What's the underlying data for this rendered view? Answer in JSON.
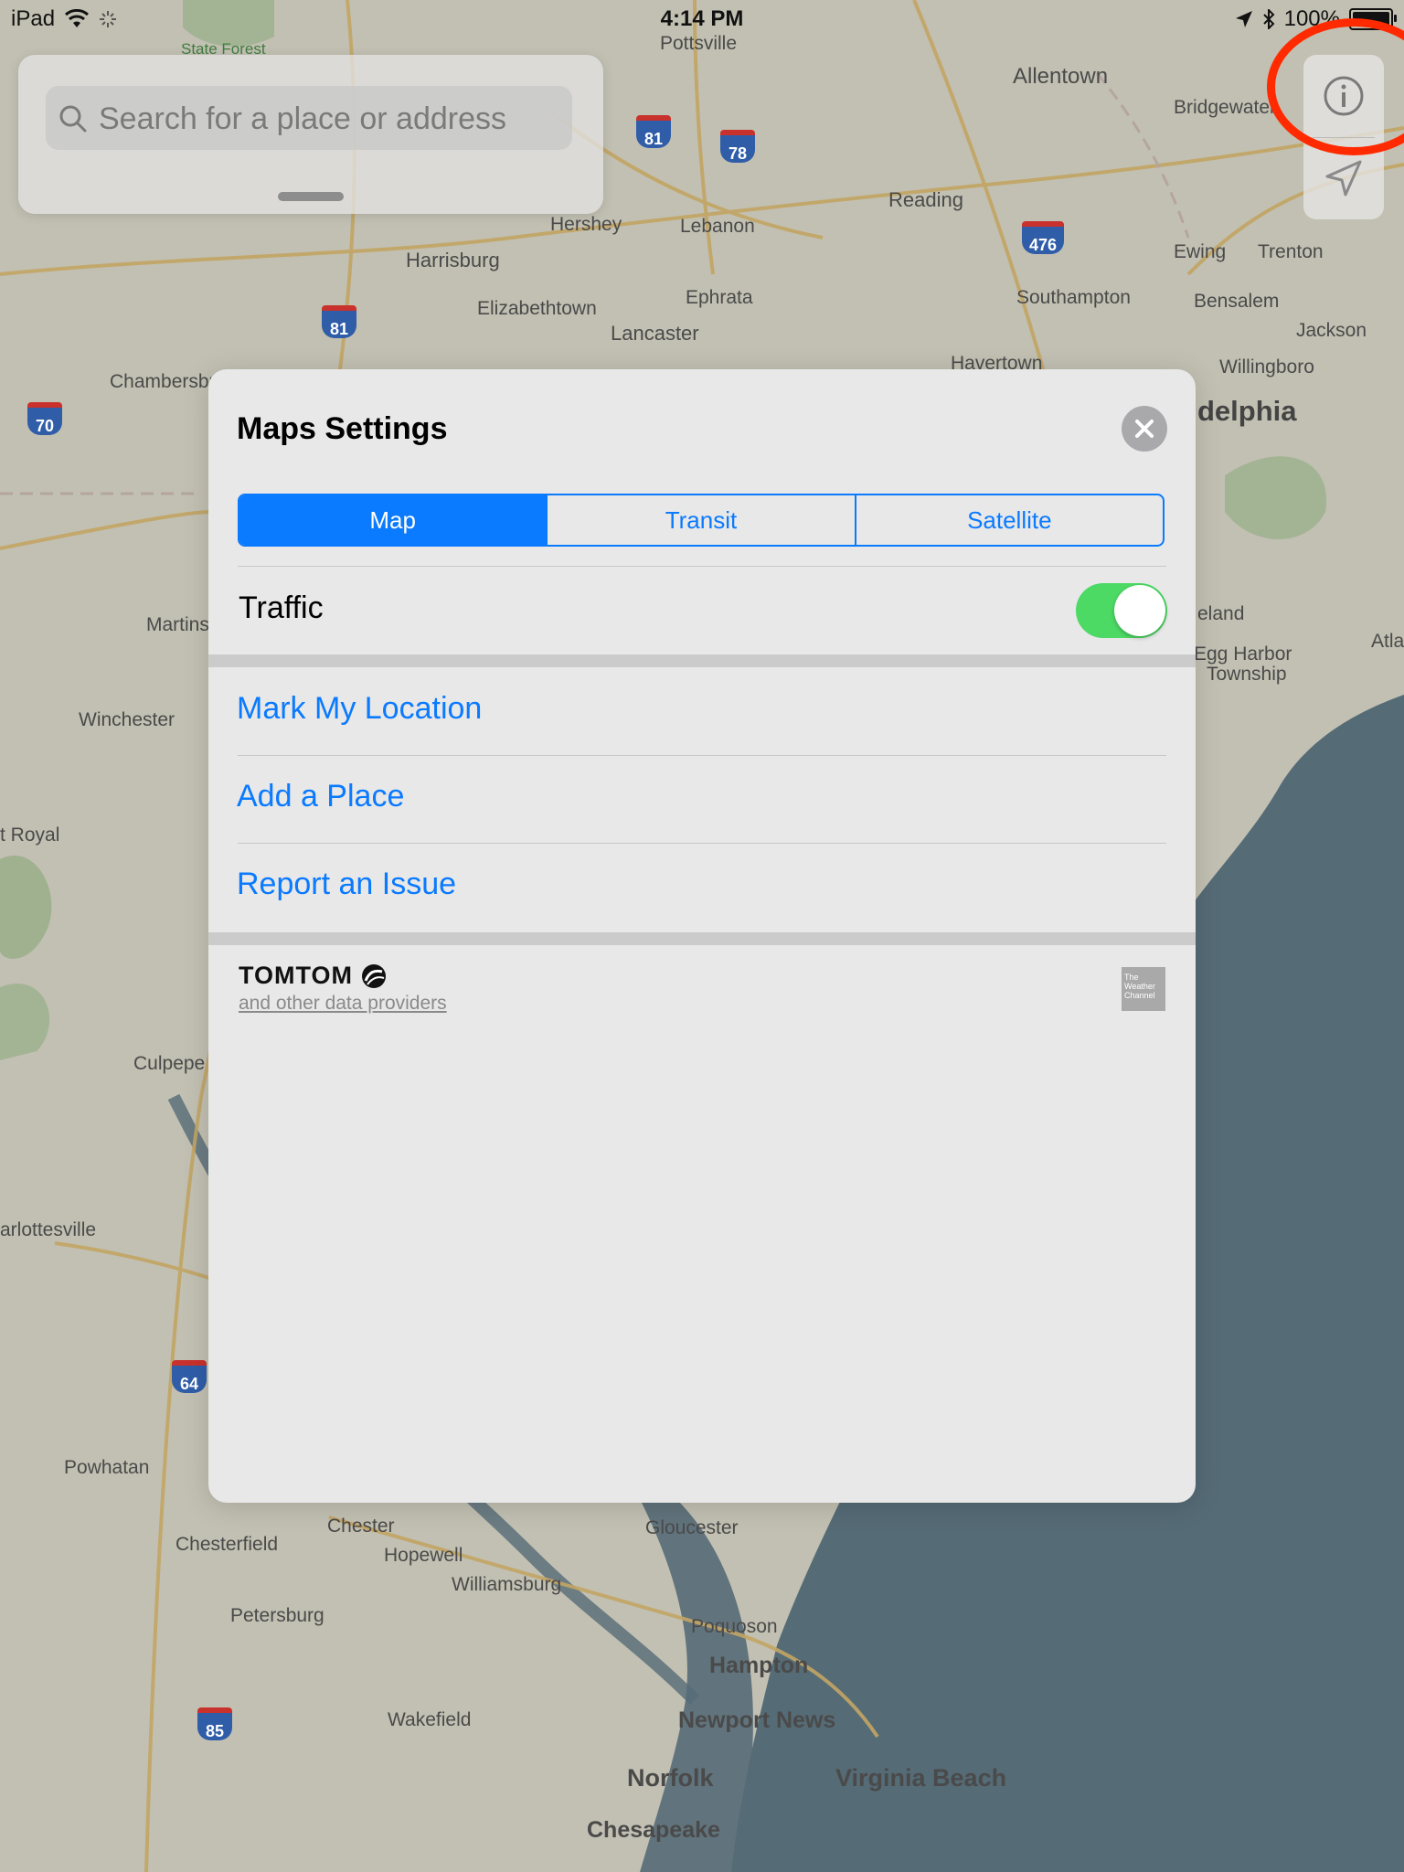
{
  "status_bar": {
    "device": "iPad",
    "time": "4:14 PM",
    "battery": "100%",
    "battery_level": 1.0
  },
  "search": {
    "placeholder": "Search for a place or address"
  },
  "map": {
    "labels": [
      "Pottsville",
      "Allentown",
      "Bridgewater",
      "Reading",
      "Lebanon",
      "Hershey",
      "Harrisburg",
      "Ephrata",
      "Elizabethtown",
      "Lancaster",
      "Southampton",
      "Ewing",
      "Trenton",
      "Bensalem",
      "Jackson",
      "Willingboro",
      "Havertown",
      "Chambersburg",
      "delphia",
      "Martins",
      "eland",
      "Egg Harbor",
      "Township",
      "Atla",
      "Winchester",
      "t Royal",
      "Culpepe",
      "arlottesville",
      "Powhatan",
      "Chester",
      "Chesterfield",
      "Hopewell",
      "Williamsburg",
      "Gloucester",
      "Petersburg",
      "Poquoson",
      "Hampton",
      "Newport News",
      "Wakefield",
      "Norfolk",
      "Virginia Beach",
      "Chesapeake",
      "State Forest"
    ],
    "shields": [
      "81",
      "78",
      "476",
      "81",
      "70",
      "64",
      "85"
    ]
  },
  "map_controls": {
    "info_icon": "info-icon",
    "location_icon": "location-arrow-icon"
  },
  "settings": {
    "title": "Maps Settings",
    "tabs": [
      {
        "label": "Map",
        "active": true
      },
      {
        "label": "Transit",
        "active": false
      },
      {
        "label": "Satellite",
        "active": false
      }
    ],
    "traffic_label": "Traffic",
    "traffic_on": true,
    "actions": [
      "Mark My Location",
      "Add a Place",
      "Report an Issue"
    ],
    "attribution": {
      "brand": "TOMTOM",
      "providers": "and other data providers",
      "weather_logo": "The Weather Channel"
    }
  },
  "colors": {
    "accent": "#0a7aff",
    "toggle_on": "#4cd964",
    "annotation": "#ff2a00"
  }
}
